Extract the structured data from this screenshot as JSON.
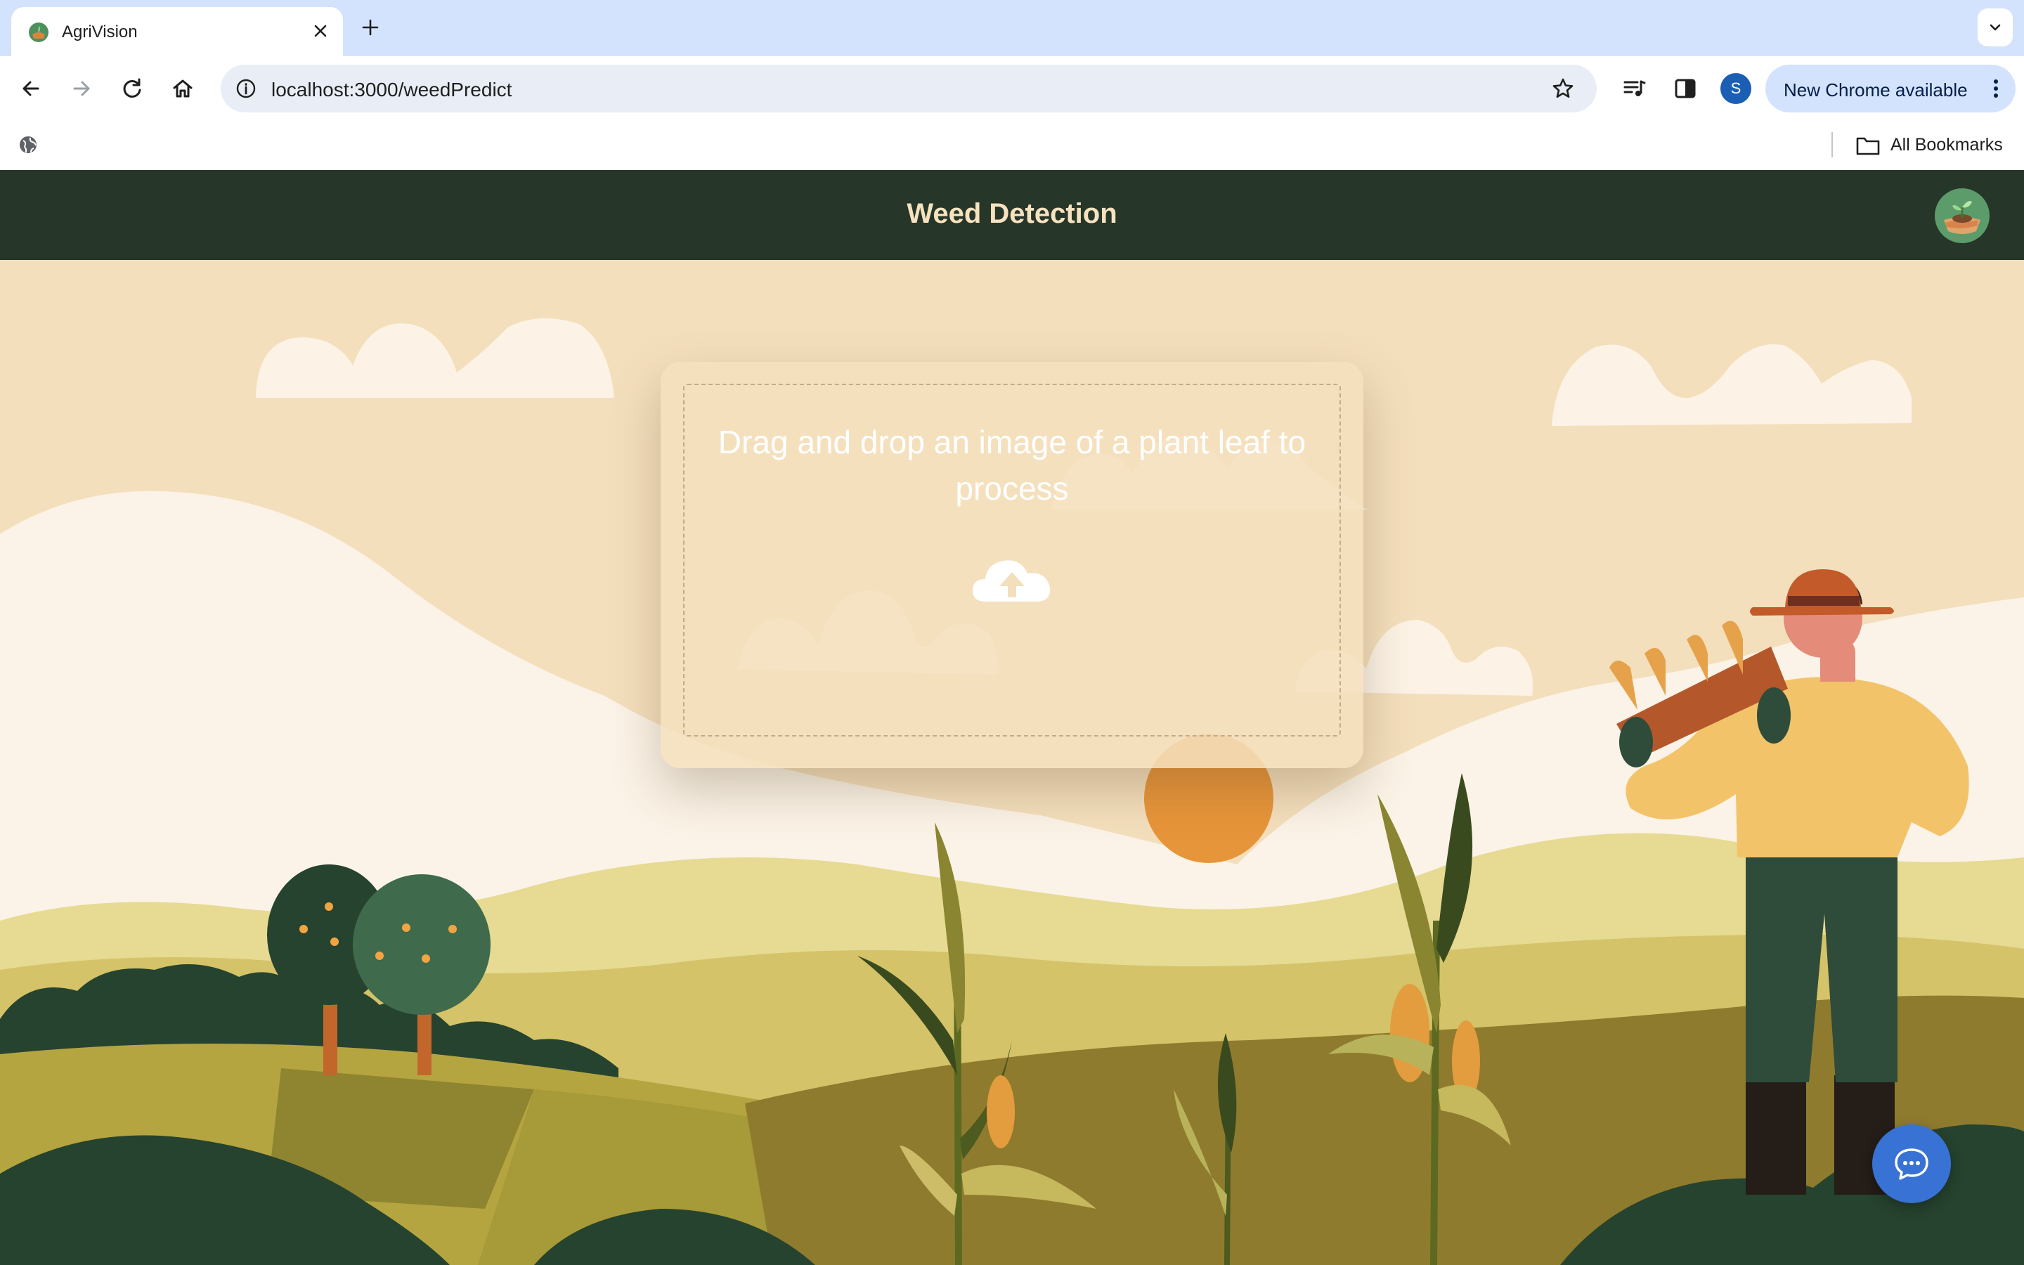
{
  "browser": {
    "tab_title": "AgriVision",
    "url": "localhost:3000/weedPredict",
    "profile_initial": "S",
    "update_label": "New Chrome available",
    "bookmarks_label": "All Bookmarks"
  },
  "app": {
    "title": "Weed Detection"
  },
  "upload": {
    "prompt": "Drag and drop an image of a plant leaf to process"
  },
  "icons": {
    "tab_favicon": "agrivision-logo-icon",
    "upload": "cloud-upload-icon",
    "chat": "chat-bubble-icon"
  },
  "colors": {
    "header_bg": "#263629",
    "header_title": "#f6e2bf",
    "sky": "#f4dfbd",
    "chat_button": "#3872d4"
  }
}
